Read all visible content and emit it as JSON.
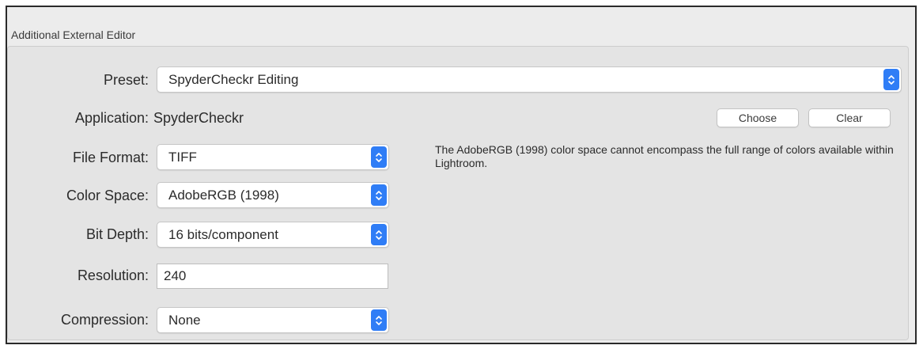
{
  "group": {
    "title": "Additional External Editor"
  },
  "preset": {
    "label": "Preset:",
    "value": "SpyderCheckr Editing"
  },
  "application": {
    "label": "Application:",
    "value": "SpyderCheckr",
    "choose_label": "Choose",
    "clear_label": "Clear"
  },
  "file_format": {
    "label": "File Format:",
    "value": "TIFF"
  },
  "color_space": {
    "label": "Color Space:",
    "value": "AdobeRGB (1998)"
  },
  "bit_depth": {
    "label": "Bit Depth:",
    "value": "16 bits/component"
  },
  "resolution": {
    "label": "Resolution:",
    "value": "240"
  },
  "compression": {
    "label": "Compression:",
    "value": "None"
  },
  "message": "The AdobeRGB (1998) color space cannot encompass the full range of colors available within Lightroom.",
  "colors": {
    "accent": "#2f7df6",
    "panel": "#e4e4e4",
    "window": "#ececec"
  },
  "icons": {
    "popup_stepper": "up-down-chevron-icon"
  }
}
